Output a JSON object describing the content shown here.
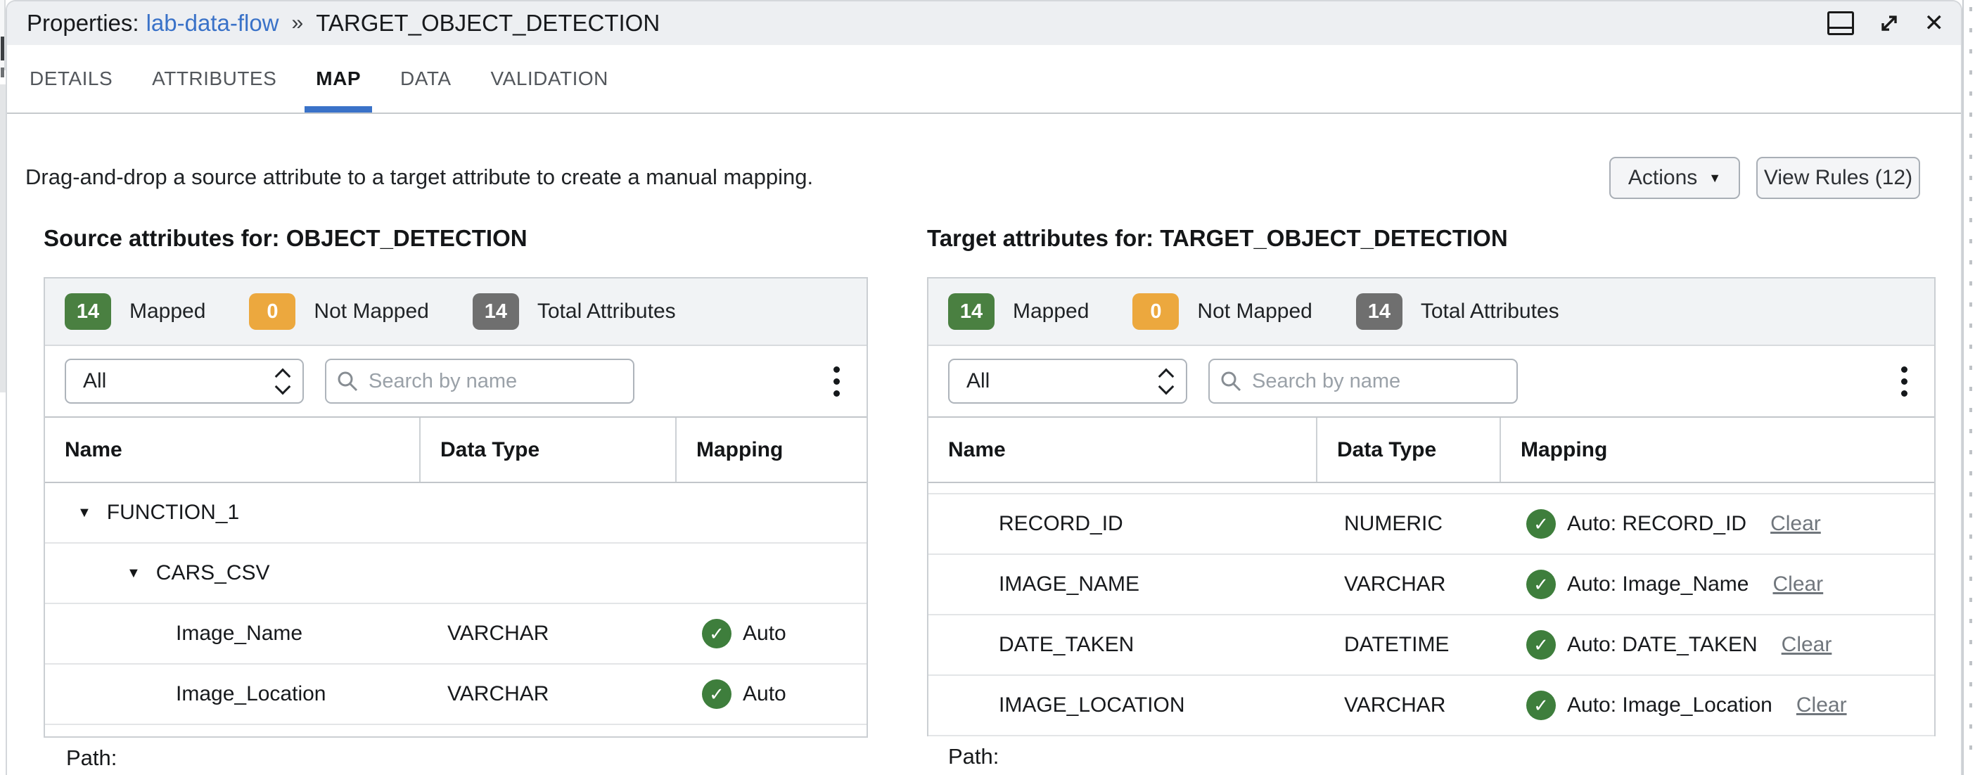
{
  "header": {
    "prefix": "Properties:",
    "link_text": "lab-data-flow",
    "breadcrumb_separator": "»",
    "target_name": "TARGET_OBJECT_DETECTION"
  },
  "tabs": [
    {
      "label": "DETAILS",
      "active": false
    },
    {
      "label": "ATTRIBUTES",
      "active": false
    },
    {
      "label": "MAP",
      "active": true
    },
    {
      "label": "DATA",
      "active": false
    },
    {
      "label": "VALIDATION",
      "active": false
    }
  ],
  "toolbar": {
    "instruction": "Drag-and-drop a source attribute to a target attribute to create a manual mapping.",
    "actions_label": "Actions",
    "view_rules_label": "View Rules (12)"
  },
  "icons": {
    "caret_glyph": "▼",
    "check_glyph": "✓",
    "close_glyph": "✕"
  },
  "colors": {
    "accent_blue": "#3A72C8",
    "link_blue": "#3A72C8",
    "mapped_green": "#4A8041",
    "not_mapped_orange": "#ECA83E",
    "total_gray": "#6F6F6F",
    "check_green": "#3E7E3C"
  },
  "source_panel": {
    "title": "Source attributes for: OBJECT_DETECTION",
    "badges": {
      "mapped": {
        "count": "14",
        "label": "Mapped"
      },
      "not_mapped": {
        "count": "0",
        "label": "Not Mapped"
      },
      "total": {
        "count": "14",
        "label": "Total Attributes"
      }
    },
    "filter": {
      "selected": "All",
      "search_placeholder": "Search by name"
    },
    "columns": [
      "Name",
      "Data Type",
      "Mapping"
    ],
    "rows": [
      {
        "type": "group",
        "level": 1,
        "name": "FUNCTION_1"
      },
      {
        "type": "group",
        "level": 2,
        "name": "CARS_CSV"
      },
      {
        "type": "attr",
        "name": "Image_Name",
        "data_type": "VARCHAR",
        "mapping": "Auto"
      },
      {
        "type": "attr",
        "name": "Image_Location",
        "data_type": "VARCHAR",
        "mapping": "Auto"
      }
    ],
    "footer_label": "Path:"
  },
  "target_panel": {
    "title": "Target attributes for: TARGET_OBJECT_DETECTION",
    "badges": {
      "mapped": {
        "count": "14",
        "label": "Mapped"
      },
      "not_mapped": {
        "count": "0",
        "label": "Not Mapped"
      },
      "total": {
        "count": "14",
        "label": "Total Attributes"
      }
    },
    "filter": {
      "selected": "All",
      "search_placeholder": "Search by name"
    },
    "columns": [
      "Name",
      "Data Type",
      "Mapping"
    ],
    "rows": [
      {
        "name": "RECORD_ID",
        "data_type": "NUMERIC",
        "mapping": "Auto: RECORD_ID",
        "clear": "Clear"
      },
      {
        "name": "IMAGE_NAME",
        "data_type": "VARCHAR",
        "mapping": "Auto: Image_Name",
        "clear": "Clear"
      },
      {
        "name": "DATE_TAKEN",
        "data_type": "DATETIME",
        "mapping": "Auto: DATE_TAKEN",
        "clear": "Clear"
      },
      {
        "name": "IMAGE_LOCATION",
        "data_type": "VARCHAR",
        "mapping": "Auto: Image_Location",
        "clear": "Clear"
      }
    ],
    "footer_label": "Path:"
  }
}
